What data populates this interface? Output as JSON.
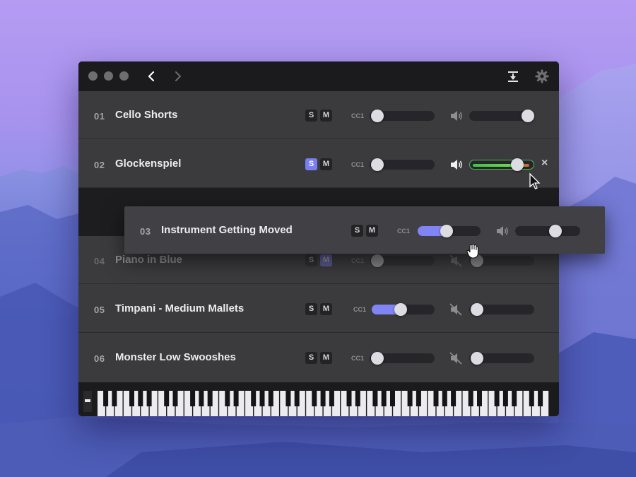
{
  "window": {
    "title_controls": [
      "close",
      "minimize",
      "zoom"
    ],
    "nav": {
      "back_icon": "chevron-left-icon",
      "forward_icon": "chevron-right-icon"
    },
    "actions": {
      "download_icon": "download-icon",
      "settings_icon": "gear-icon"
    }
  },
  "tracks": [
    {
      "num": "01",
      "name": "Cello Shorts",
      "solo": false,
      "mute": false,
      "cc_label": "CC1",
      "cc": 0.0,
      "speaker": "on",
      "volume": 1.0,
      "meter": 0
    },
    {
      "num": "02",
      "name": "Glockenspiel",
      "solo": true,
      "mute": false,
      "cc_label": "CC1",
      "cc": 0.0,
      "speaker": "on",
      "volume": 0.85,
      "meter": 0.9,
      "close_label": "×"
    },
    {
      "num": "03",
      "name": "Instrument Getting Moved",
      "solo": false,
      "mute": false,
      "cc_label": "CC1",
      "cc": 0.45,
      "speaker": "on",
      "volume": 0.65,
      "meter": 0
    },
    {
      "num": "04",
      "name": "Piano in Blue",
      "solo": false,
      "mute": true,
      "cc_label": "CC1",
      "cc": 0.0,
      "speaker": "muted",
      "volume": 0.0,
      "meter": 0
    },
    {
      "num": "05",
      "name": "Timpani - Medium Mallets",
      "solo": false,
      "mute": false,
      "cc_label": "CC1",
      "cc": 0.45,
      "speaker": "muted",
      "volume": 0.0,
      "meter": 0
    },
    {
      "num": "06",
      "name": "Monster Low Swooshes",
      "solo": false,
      "mute": false,
      "cc_label": "CC1",
      "cc": 0.0,
      "speaker": "muted",
      "volume": 0.0,
      "meter": 0
    }
  ],
  "buttons": {
    "solo": "S",
    "mute": "M"
  },
  "colors": {
    "accent": "#7b7ef0",
    "meter_green": "#3fc04f",
    "meter_red": "#e0503a",
    "bg_panel": "#3b3b3e"
  }
}
